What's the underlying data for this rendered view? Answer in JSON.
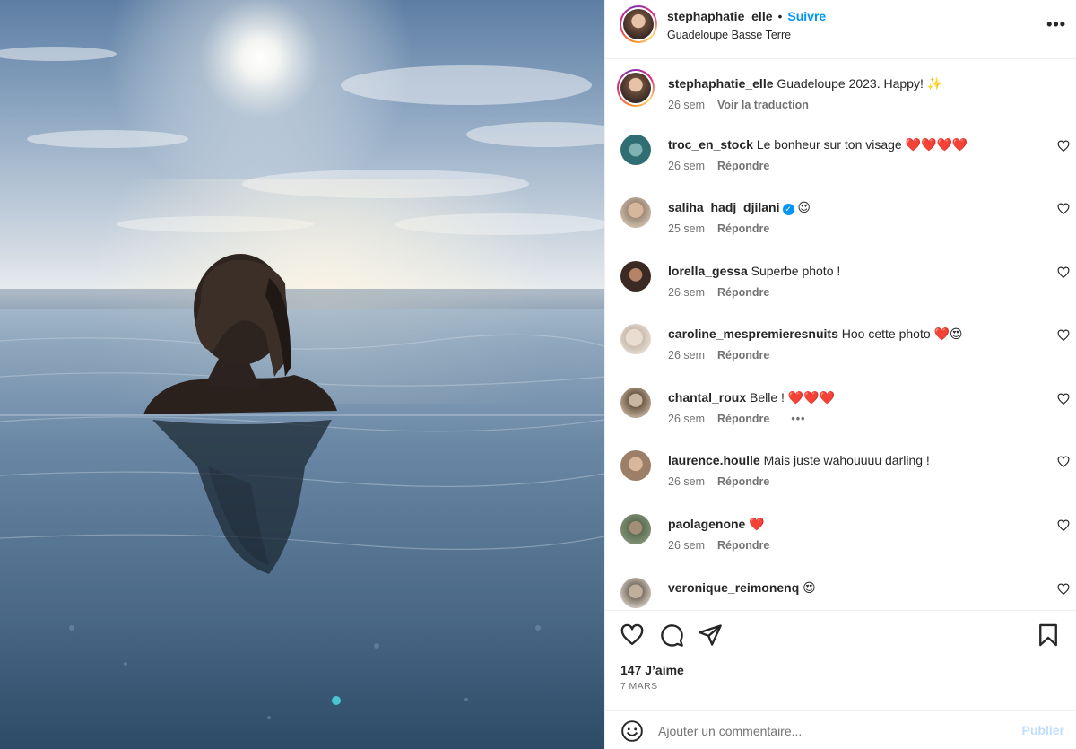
{
  "header": {
    "username": "stephaphatie_elle",
    "separator": "•",
    "follow_label": "Suivre",
    "location": "Guadeloupe Basse Terre",
    "more_icon": "more-horizontal-icon"
  },
  "caption": {
    "username": "stephaphatie_elle",
    "text": "Guadeloupe 2023. Happy! ✨",
    "time": "26 sem",
    "translate_label": "Voir la traduction"
  },
  "comments": [
    {
      "username": "troc_en_stock",
      "text": "Le bonheur sur ton visage ❤️❤️❤️❤️",
      "time": "26 sem",
      "reply": "Répondre",
      "verified": false,
      "avatar_color": "#2f6e73"
    },
    {
      "username": "saliha_hadj_djilani",
      "text": "😍",
      "time": "25 sem",
      "reply": "Répondre",
      "verified": true,
      "avatar_color": "#c9b8a6"
    },
    {
      "username": "lorella_gessa",
      "text": "Superbe photo !",
      "time": "26 sem",
      "reply": "Répondre",
      "verified": false,
      "avatar_color": "#3b2a24"
    },
    {
      "username": "caroline_mespremieresnuits",
      "text": "Hoo cette photo ❤️😍",
      "time": "26 sem",
      "reply": "Répondre",
      "verified": false,
      "avatar_color": "#d8cfc7"
    },
    {
      "username": "chantal_roux",
      "text": "Belle ! ❤️❤️❤️",
      "time": "26 sem",
      "reply": "Répondre",
      "verified": false,
      "avatar_color": "#b7a48f",
      "more": "•••"
    },
    {
      "username": "laurence.houlle",
      "text": "Mais juste wahouuuu darling !",
      "time": "26 sem",
      "reply": "Répondre",
      "verified": false,
      "avatar_color": "#9d7f68"
    },
    {
      "username": "paolagenone",
      "text": "❤️",
      "time": "26 sem",
      "reply": "Répondre",
      "verified": false,
      "avatar_color": "#7e8f74"
    },
    {
      "username": "veronique_reimonenq",
      "text": "😍",
      "time": "26 sem",
      "reply": "Répondre",
      "verified": false,
      "avatar_color": "#c8bfb4"
    }
  ],
  "actions": {
    "like_icon": "heart-icon",
    "comment_icon": "comment-icon",
    "share_icon": "send-icon",
    "save_icon": "bookmark-icon"
  },
  "likes_text": "147 J’aime",
  "date_text": "7 MARS",
  "comment_box": {
    "placeholder": "Ajouter un commentaire...",
    "post_label": "Publier",
    "emoji_icon": "emoji-icon"
  },
  "colors": {
    "accent": "#0095f6",
    "post_disabled": "#c0dffd",
    "heart_red": "#e0162b"
  }
}
